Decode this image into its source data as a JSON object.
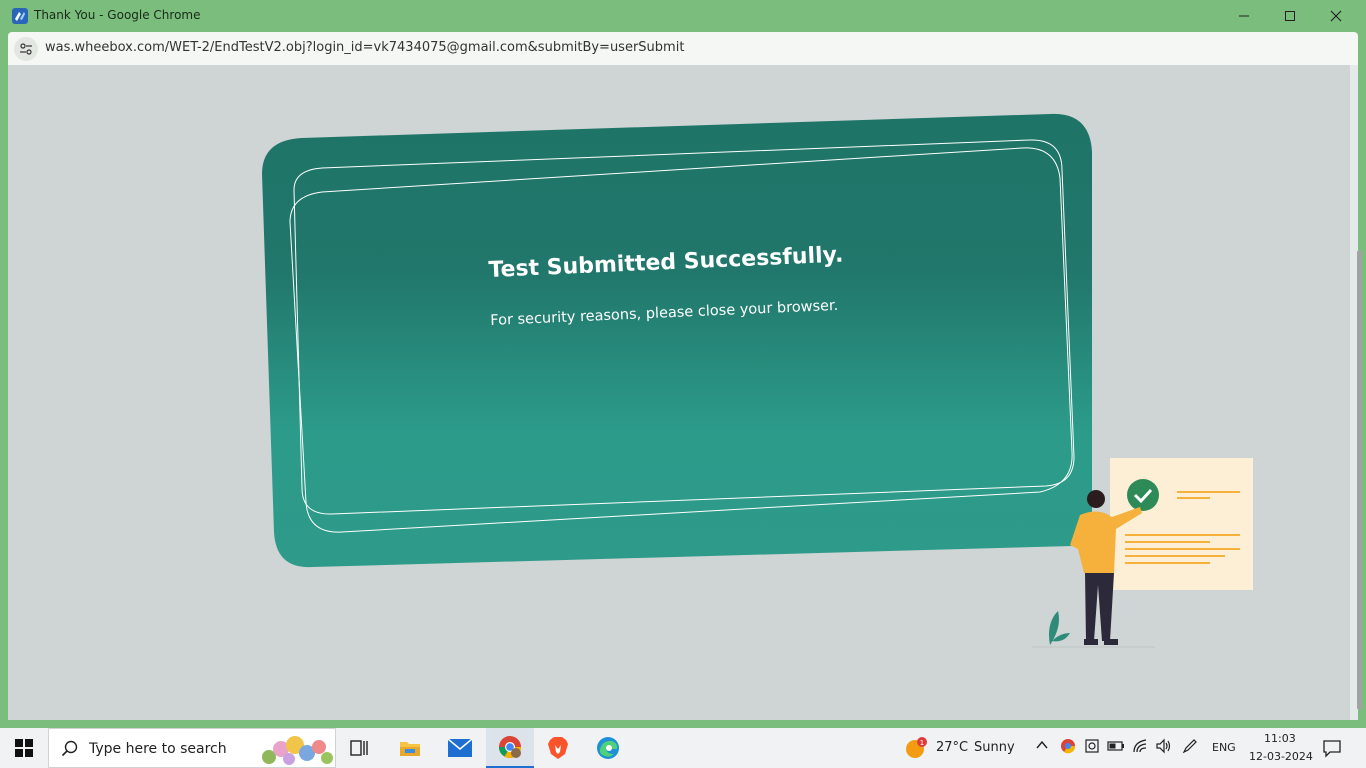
{
  "window": {
    "title": "Thank You - Google Chrome",
    "minimize_icon": "minimize-icon",
    "maximize_icon": "maximize-icon",
    "close_icon": "close-icon"
  },
  "address_bar": {
    "url": "was.wheebox.com/WET-2/EndTestV2.obj?login_id=vk7434075@gmail.com&submitBy=userSubmit",
    "site_info_icon": "tune-icon"
  },
  "card": {
    "title": "Test Submitted Successfully.",
    "message": "For security reasons, please close your browser.",
    "color_top": "#1f7468",
    "color_bottom": "#2e9e8c"
  },
  "taskbar": {
    "search_placeholder": "Type here to search",
    "apps": [
      "task-view",
      "file-explorer",
      "mail",
      "chrome",
      "brave",
      "edge"
    ],
    "weather": {
      "temperature": "27°C",
      "condition": "Sunny",
      "badge": "1"
    },
    "language": "ENG",
    "time": "11:03",
    "date": "12-03-2024"
  },
  "colors": {
    "window_frame": "#7bbd7d",
    "page_background": "#cfd4d4",
    "accent_yellow": "#f5b13b",
    "check_green": "#2e8b57"
  }
}
